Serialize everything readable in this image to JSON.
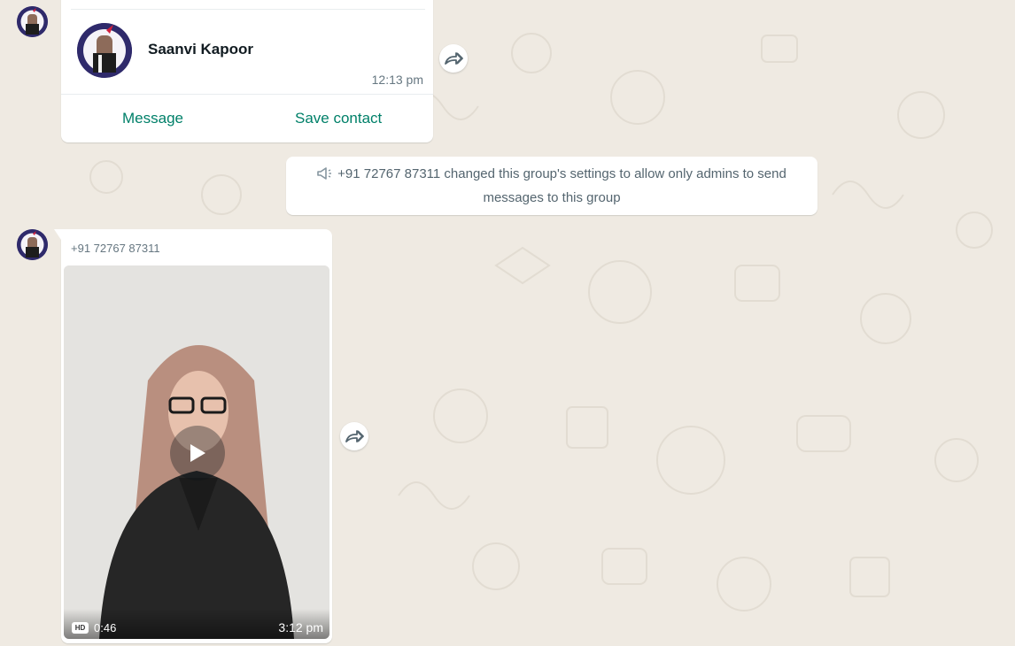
{
  "contact_card": {
    "name": "Saanvi Kapoor",
    "time": "12:13 pm",
    "actions": {
      "message": "Message",
      "save_contact": "Save contact"
    }
  },
  "system_message": {
    "icon": "megaphone-icon",
    "text": "+91 72767 87311 changed this group's settings to allow only admins to send messages to this group"
  },
  "video_message": {
    "sender": "+91 72767 87311",
    "badge": "HD",
    "duration": "0:46",
    "time": "3:12 pm"
  },
  "colors": {
    "background": "#efeae2",
    "bubble": "#ffffff",
    "accent": "#008069",
    "meta_text": "#667781"
  }
}
